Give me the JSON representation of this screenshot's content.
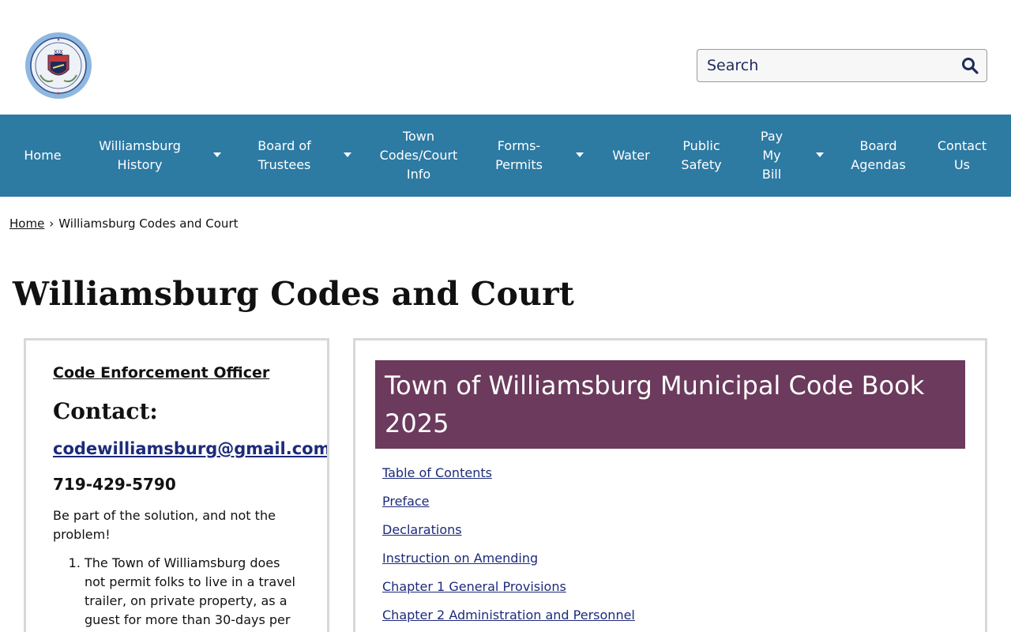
{
  "header": {
    "search": {
      "placeholder": "Search"
    },
    "logo": {
      "text": "TOWN OF WILLIAMSBURG COLORADO",
      "year": "XIX"
    }
  },
  "nav": {
    "items": [
      {
        "label": "Home",
        "has_dropdown": false
      },
      {
        "label": "Williamsburg History",
        "has_dropdown": true
      },
      {
        "label": "Board of Trustees",
        "has_dropdown": true
      },
      {
        "label": "Town Codes/Court Info",
        "has_dropdown": false
      },
      {
        "label": "Forms-Permits",
        "has_dropdown": true
      },
      {
        "label": "Water",
        "has_dropdown": false
      },
      {
        "label": "Public Safety",
        "has_dropdown": false
      },
      {
        "label": "Pay My Bill",
        "has_dropdown": true
      },
      {
        "label": "Board Agendas",
        "has_dropdown": false
      },
      {
        "label": "Contact Us",
        "has_dropdown": false
      }
    ]
  },
  "breadcrumb": {
    "home": "Home",
    "separator": "›",
    "current": "Williamsburg Codes and Court"
  },
  "page": {
    "title": "Williamsburg Codes and Court"
  },
  "left_card": {
    "officer_heading": "Code Enforcement Officer",
    "contact_heading": "Contact:",
    "email": "codewilliamsburg@gmail.com",
    "phone": "719-429-5790",
    "tagline": "Be part of the solution, and not the problem!",
    "rules": [
      "The Town of Williamsburg does not permit folks to live in a travel trailer, on private property, as a guest for more than 30-days per"
    ]
  },
  "right_card": {
    "banner_title": "Town of Williamsburg Municipal Code Book 2025",
    "links": [
      "Table of Contents",
      "Preface",
      "Declarations",
      "Instruction on Amending",
      "Chapter 1 General Provisions",
      "Chapter 2 Administration and Personnel"
    ]
  },
  "colors": {
    "nav_bg": "#2d7aa3",
    "banner_bg": "#6b3a5c",
    "link": "#1d2b7a",
    "search_text": "#1d2b5c"
  }
}
